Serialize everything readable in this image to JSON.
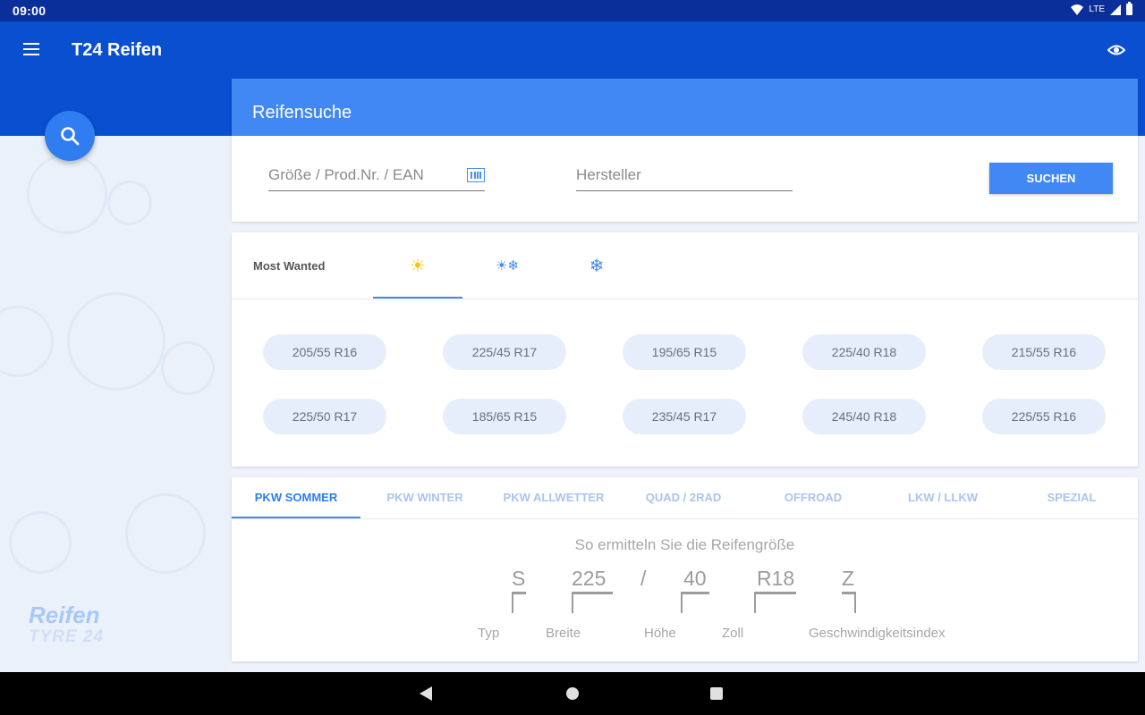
{
  "status": {
    "time": "09:00",
    "network": "LTE"
  },
  "appbar": {
    "title": "T24 Reifen",
    "menu_icon": "menu-icon",
    "eye_icon": "eye-icon"
  },
  "sidebar": {
    "fab_icon": "search-icon",
    "logo_line1": "Reifen",
    "logo_line2": "TYRE 24"
  },
  "search": {
    "title": "Reifensuche",
    "size_placeholder": "Größe / Prod.Nr. / EAN",
    "manufacturer_placeholder": "Hersteller",
    "button_label": "SUCHEN",
    "barcode_icon": "barcode-icon"
  },
  "most_wanted": {
    "label": "Most Wanted",
    "season_tabs": [
      {
        "icon": "sun-icon",
        "glyph": "☀",
        "color": "#f5c518",
        "active": true
      },
      {
        "icon": "all-season-icon",
        "glyph": "☀❄",
        "color": "#4188f5",
        "active": false
      },
      {
        "icon": "snowflake-icon",
        "glyph": "❄",
        "color": "#4188f5",
        "active": false
      }
    ],
    "sizes": [
      "205/55 R16",
      "225/45 R17",
      "195/65 R15",
      "225/40 R18",
      "215/55 R16",
      "225/50 R17",
      "185/65 R15",
      "235/45 R17",
      "245/40 R18",
      "225/55 R16"
    ]
  },
  "categories": {
    "tabs": [
      "PKW SOMMER",
      "PKW WINTER",
      "PKW ALLWETTER",
      "QUAD / 2RAD",
      "OFFROAD",
      "LKW / LLKW",
      "SPEZIAL"
    ],
    "active_index": 0
  },
  "size_guide": {
    "title": "So ermitteln Sie die Reifengröße",
    "parts": [
      "S",
      "225",
      "/",
      "40",
      "R18",
      "Z"
    ],
    "labels": [
      "Typ",
      "Breite",
      "Höhe",
      "Zoll",
      "Geschwindigkeitsindex"
    ]
  },
  "colors": {
    "primary": "#0a4fd0",
    "accent": "#4188f5",
    "statusbar": "#0a2f9a"
  }
}
